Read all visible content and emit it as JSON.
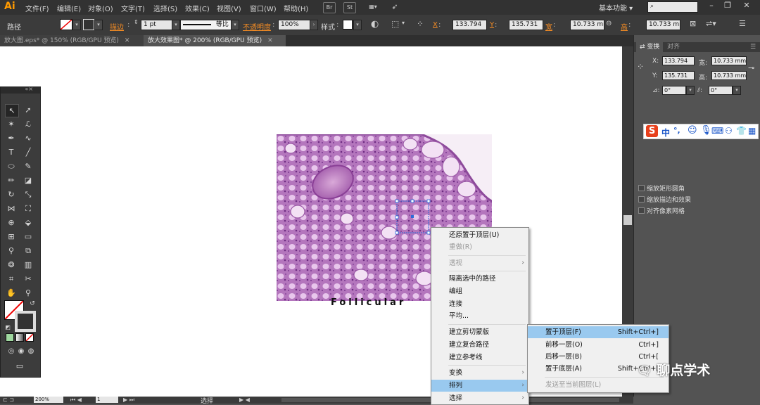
{
  "menubar": {
    "logo": "Ai",
    "items": [
      "文件(F)",
      "编辑(E)",
      "对象(O)",
      "文字(T)",
      "选择(S)",
      "效果(C)",
      "视图(V)",
      "窗口(W)",
      "帮助(H)"
    ],
    "icon_br": "Br",
    "icon_st": "St",
    "workspace": "基本功能",
    "window_controls": [
      "–",
      "❐",
      "✕"
    ]
  },
  "control_bar": {
    "object_type": "路径",
    "stroke_label": "描边",
    "stroke_value": "1 pt",
    "stroke_profile": "等比",
    "opacity_label": "不透明度",
    "opacity_value": "100%",
    "style_label": "样式",
    "x_label": "X",
    "x_value": "133.794",
    "y_label": "Y",
    "y_value": "135.731",
    "w_label": "宽",
    "w_value": "10.733 mm",
    "h_label": "高",
    "h_value": "10.733 mm"
  },
  "tabs": [
    {
      "label": "放大图.eps* @ 150% (RGB/GPU 预览)",
      "close": "✕"
    },
    {
      "label": "放大效果图* @ 200% (RGB/GPU 预览)",
      "close": "✕"
    }
  ],
  "caption_partial": "Follicular cell",
  "transform_panel": {
    "tabs": [
      "变换",
      "对齐"
    ],
    "x_label": "X:",
    "x_value": "133.794",
    "y_label": "Y:",
    "y_value": "135.731",
    "w_label": "宽:",
    "w_value": "10.733 mm",
    "h_label": "高:",
    "h_value": "10.733 mm",
    "rotate_value": "0°",
    "shear_value": "0°",
    "options": [
      "缩放矩形圆角",
      "缩放描边和效果",
      "对齐像素网格"
    ]
  },
  "ime_toolbar": {
    "brand": "S",
    "mode": "中",
    "punct": "°,"
  },
  "context_menu": [
    {
      "label": "还原置于顶层(U)",
      "disabled": false
    },
    {
      "label": "重做(R)",
      "disabled": true
    },
    {
      "label": "透视",
      "disabled": true,
      "arrow": "›"
    },
    {
      "label": "隔离选中的路径",
      "disabled": false
    },
    {
      "label": "编组",
      "disabled": false
    },
    {
      "label": "连接",
      "disabled": false
    },
    {
      "label": "平均...",
      "disabled": false
    },
    {
      "label": "建立剪切蒙版",
      "disabled": false
    },
    {
      "label": "建立复合路径",
      "disabled": false
    },
    {
      "label": "建立参考线",
      "disabled": false
    },
    {
      "label": "变换",
      "disabled": false,
      "arrow": "›"
    },
    {
      "label": "排列",
      "disabled": false,
      "arrow": "›",
      "highlighted": true
    },
    {
      "label": "选择",
      "disabled": false,
      "arrow": "›"
    }
  ],
  "arrange_submenu": [
    {
      "label": "置于顶层(F)",
      "shortcut": "Shift+Ctrl+]",
      "highlighted": true
    },
    {
      "label": "前移一层(O)",
      "shortcut": "Ctrl+]"
    },
    {
      "label": "后移一层(B)",
      "shortcut": "Ctrl+["
    },
    {
      "label": "置于底层(A)",
      "shortcut": "Shift+Ctrl+["
    },
    {
      "label": "发送至当前图层(L)",
      "shortcut": "",
      "disabled": true
    }
  ],
  "status_bar": {
    "zoom": "200%",
    "page": "1",
    "tool": "选择"
  },
  "watermark": "聊点学术"
}
